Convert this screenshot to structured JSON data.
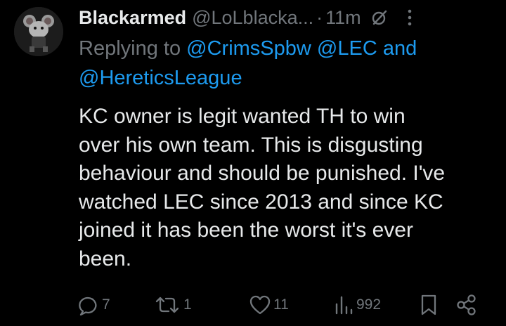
{
  "tweet": {
    "avatar_icon": "avatar-image",
    "display_name": "Blackarmed",
    "handle": "@LoLblacka...",
    "separator": "·",
    "time": "11m",
    "reply": {
      "prefix": "Replying to",
      "mention_1": "@CrimsSpbw",
      "mention_2": "@LEC",
      "conjunction": "and",
      "mention_3": "@HereticsLeague"
    },
    "text_lines": [
      "KC owner is legit wanted TH to win",
      "over his own team. This is disgusting",
      "behaviour and should be punished. I've",
      "watched LEC since 2013 and since KC",
      "joined it has been the worst it's ever",
      "been."
    ]
  },
  "actions": {
    "replies": "7",
    "retweets": "1",
    "likes": "11",
    "views": "992"
  },
  "colors": {
    "background": "#000000",
    "text": "#e7e9ea",
    "secondary": "#71767b",
    "accent": "#1d9bf0"
  }
}
